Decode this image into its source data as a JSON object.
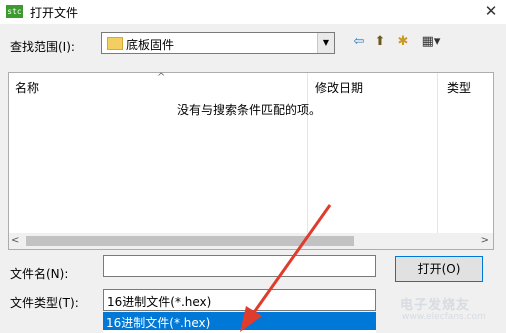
{
  "window": {
    "title": "打开文件",
    "app_icon_text": "stc",
    "close_glyph": "✕"
  },
  "lookin": {
    "label": "查找范围(I):",
    "value": "底板固件",
    "dropdown_glyph": "▼"
  },
  "toolbar": {
    "back_glyph": "⇦",
    "up_glyph": "⬆",
    "new_folder_glyph": "✱",
    "view_glyph": "▦▾"
  },
  "filelist": {
    "columns": [
      "名称",
      "修改日期",
      "类型"
    ],
    "sort_glyph": "^",
    "empty_message": "没有与搜索条件匹配的项。",
    "scroll_left_glyph": "<",
    "scroll_right_glyph": ">"
  },
  "filename": {
    "label": "文件名(N):",
    "value": "",
    "placeholder": ""
  },
  "filetype": {
    "label": "文件类型(T):",
    "value": "16进制文件(*.hex)",
    "options": [
      "16进制文件(*.hex)"
    ]
  },
  "open_button": {
    "label": "打开(O)"
  },
  "watermark": {
    "text": "电子发烧友",
    "url": "www.elecfans.com"
  },
  "colors": {
    "accent": "#0078d7",
    "arrow": "#e03c2e",
    "app_icon": "#3c9a2e",
    "folder": "#f3cf62"
  }
}
